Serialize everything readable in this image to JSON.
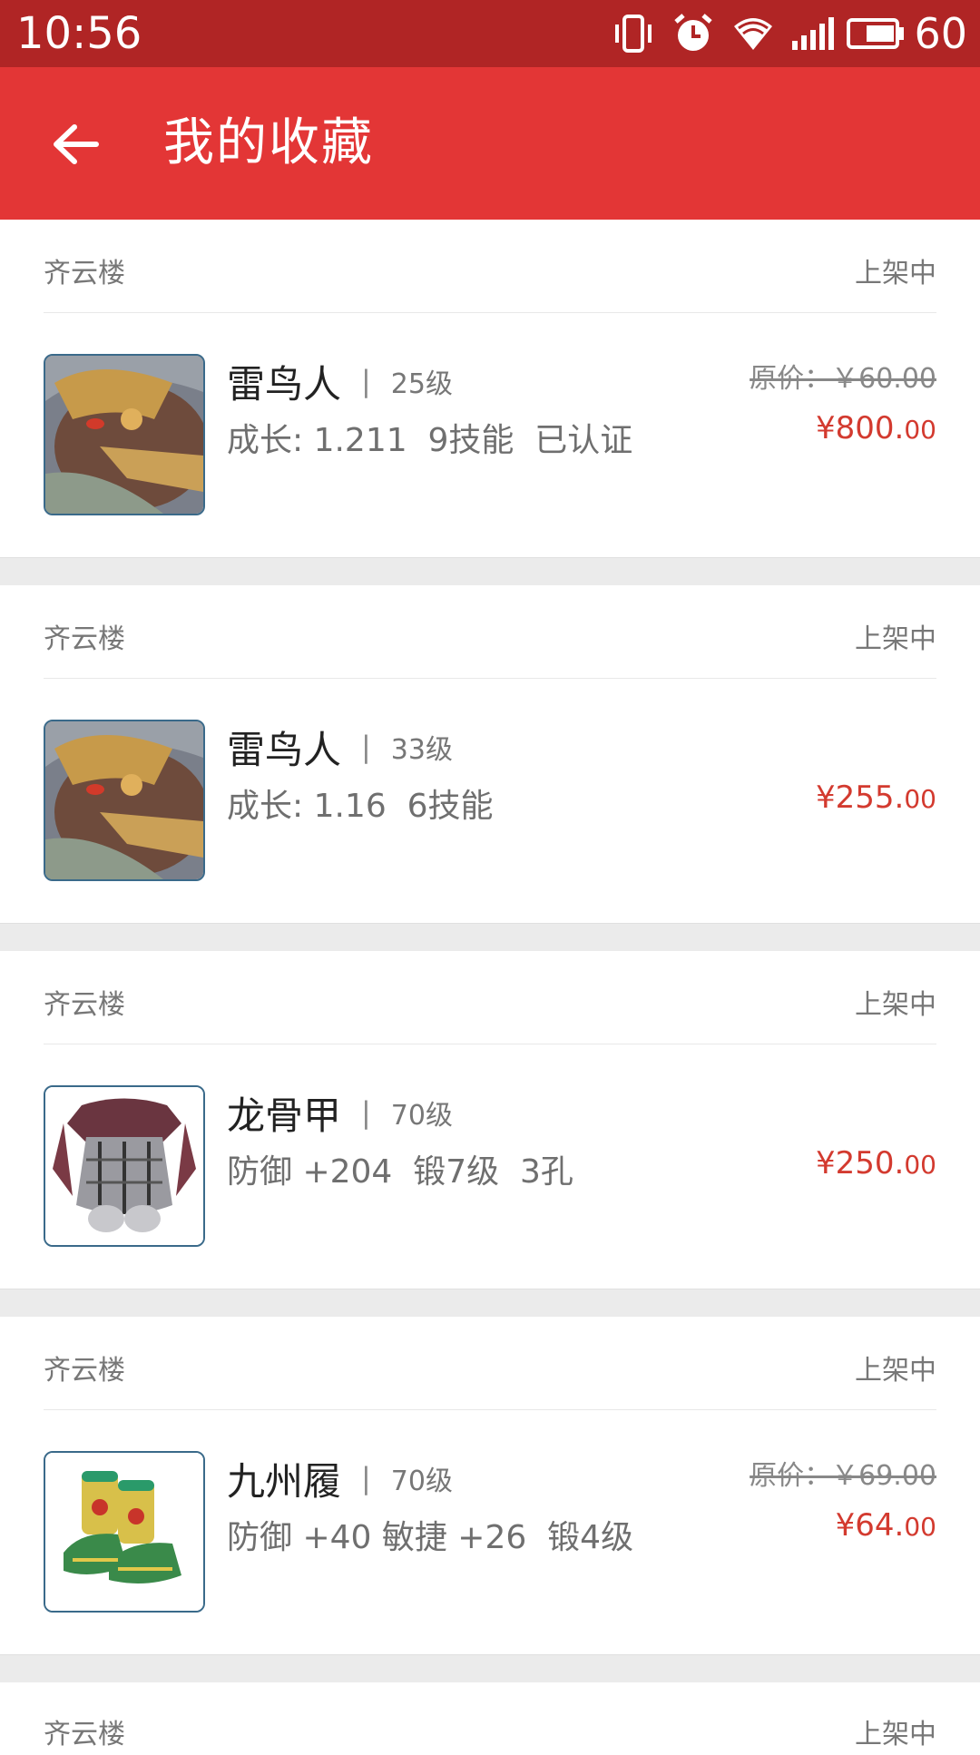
{
  "status_bar": {
    "time": "10:56",
    "icons": [
      "vibrate-icon",
      "alarm-icon",
      "wifi-icon",
      "signal-icon",
      "battery-icon"
    ],
    "battery": "60"
  },
  "app_bar": {
    "title": "我的收藏"
  },
  "items": [
    {
      "seller": "齐云楼",
      "state": "上架中",
      "name": "雷鸟人",
      "level": "25级",
      "attrs": "成长: 1.211  9技能  已认证",
      "original_price": "原价：￥60.00",
      "price_main": "¥800.",
      "price_cents": "00",
      "thumb": "thunderbird-monster"
    },
    {
      "seller": "齐云楼",
      "state": "上架中",
      "name": "雷鸟人",
      "level": "33级",
      "attrs": "成长: 1.16  6技能",
      "original_price": "",
      "price_main": "¥255.",
      "price_cents": "00",
      "thumb": "thunderbird-monster"
    },
    {
      "seller": "齐云楼",
      "state": "上架中",
      "name": "龙骨甲",
      "level": "70级",
      "attrs": "防御 +204  锻7级  3孔",
      "original_price": "",
      "price_main": "¥250.",
      "price_cents": "00",
      "thumb": "dragon-bone-armor"
    },
    {
      "seller": "齐云楼",
      "state": "上架中",
      "name": "九州履",
      "level": "70级",
      "attrs": "防御 +40 敏捷 +26  锻4级",
      "original_price": "原价：￥69.00",
      "price_main": "¥64.",
      "price_cents": "00",
      "thumb": "jiuzhou-boots"
    }
  ],
  "partial_item": {
    "seller": "齐云楼",
    "state": "上架中"
  }
}
